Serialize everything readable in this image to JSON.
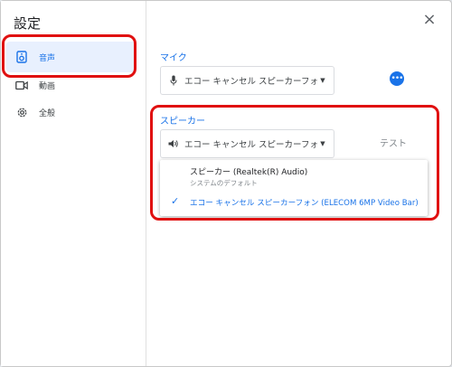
{
  "dialog": {
    "title": "設定",
    "close_label": "×"
  },
  "sidebar": {
    "items": [
      {
        "label": "音声",
        "icon": "speaker-icon",
        "selected": true
      },
      {
        "label": "動画",
        "icon": "video-camera-icon",
        "selected": false
      },
      {
        "label": "全般",
        "icon": "gear-icon",
        "selected": false
      }
    ]
  },
  "microphone": {
    "label": "マイク",
    "selected": "エコー キャンセル スピーカーフォン ..."
  },
  "speaker": {
    "label": "スピーカー",
    "selected": "エコー キャンセル スピーカーフォン ...",
    "test_label": "テスト",
    "options": [
      {
        "title": "スピーカー (Realtek(R) Audio)",
        "subtitle": "システムのデフォルト",
        "checked": false
      },
      {
        "title": "エコー キャンセル スピーカーフォン (ELECOM 6MP Video Bar)",
        "subtitle": "",
        "checked": true
      }
    ],
    "check_glyph": "✓"
  },
  "colors": {
    "accent": "#1a73e8",
    "highlight": "#e01010",
    "selected_bg": "#e8f0fe"
  }
}
